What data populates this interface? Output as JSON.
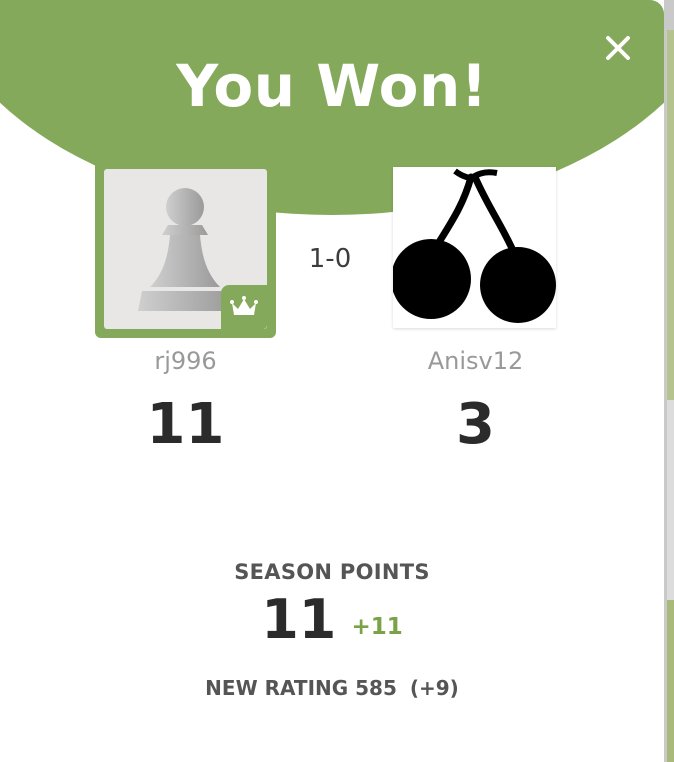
{
  "modal": {
    "title": "You Won!",
    "close_icon": "close-icon",
    "score": "1-0"
  },
  "players": {
    "left": {
      "username": "rj996",
      "points": "11",
      "avatar_icon": "pawn-icon",
      "badge_icon": "crown-icon"
    },
    "right": {
      "username": "Anisv12",
      "points": "3",
      "avatar_icon": "cherry-icon"
    }
  },
  "season": {
    "label": "SEASON POINTS",
    "value": "11",
    "delta": "+11"
  },
  "rating": {
    "label": "NEW RATING 585",
    "change": "(+9)"
  },
  "colors": {
    "accent": "#84a95a",
    "positive": "#7aa246",
    "text_dark": "#2b2b2b",
    "text_muted": "#999999"
  }
}
